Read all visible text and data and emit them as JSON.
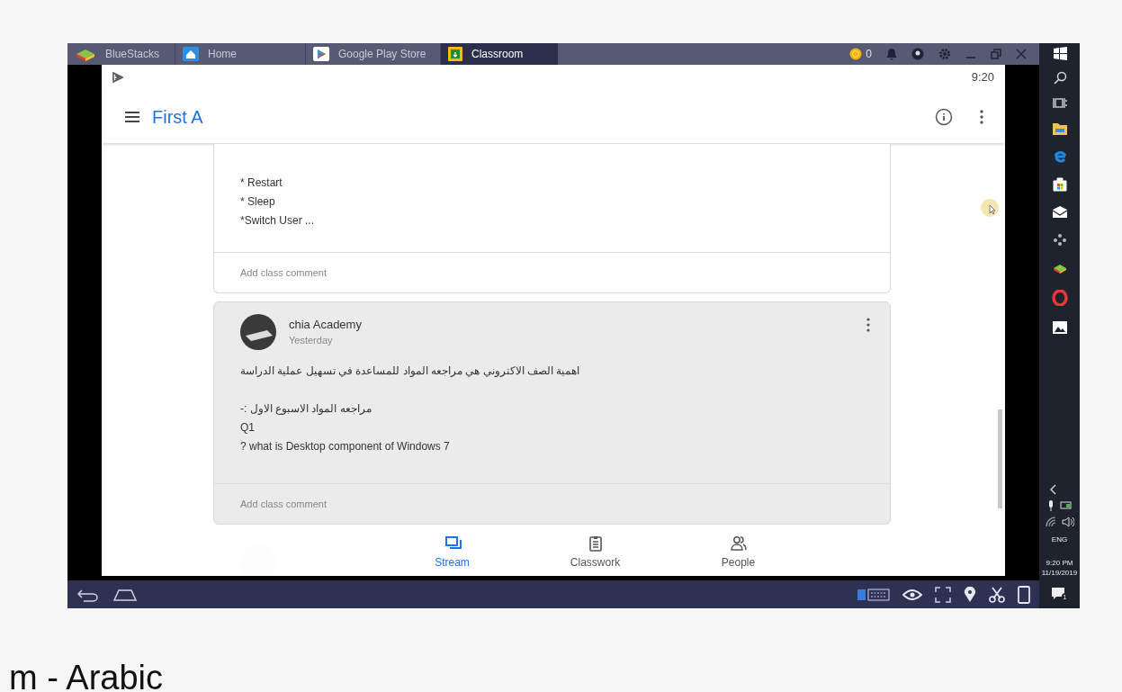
{
  "emulator": {
    "tabs": [
      {
        "label": "BlueStacks",
        "kind": "brand",
        "selected": false
      },
      {
        "label": "Home",
        "kind": "home",
        "selected": false
      },
      {
        "label": "Google Play Store",
        "kind": "store",
        "selected": false
      },
      {
        "label": "Classroom",
        "kind": "classroom",
        "selected": true
      }
    ],
    "coins": "0"
  },
  "status_bar": {
    "time": "9:20"
  },
  "app_bar": {
    "title": "First A"
  },
  "posts": [
    {
      "kind": "partial",
      "highlighted": false,
      "paragraphs": [
        [
          "* Restart",
          "* Sleep",
          "*Switch User ..."
        ]
      ],
      "comment_placeholder": "Add class comment"
    },
    {
      "kind": "full",
      "highlighted": true,
      "author": "chia Academy",
      "date": "Yesterday",
      "paragraphs": [
        [
          "اهمية الصف الاكتروني هي مراجعه المواد للمساعدة في تسهيل عملية الدراسة"
        ],
        [
          "مراجعه المواد الاسبوع الاول :-",
          "Q1",
          "? what is Desktop component of Windows 7"
        ]
      ],
      "comment_placeholder": "Add class comment"
    }
  ],
  "bottom_nav": [
    {
      "label": "Stream",
      "kind": "stream",
      "selected": true
    },
    {
      "label": "Classwork",
      "kind": "classwork",
      "selected": false
    },
    {
      "label": "People",
      "kind": "people",
      "selected": false
    }
  ],
  "taskbar": {
    "language": "ENG",
    "time": "9:20 PM",
    "date": "11/19/2019",
    "notification_count": "1"
  },
  "caption": "m - Arabic"
}
